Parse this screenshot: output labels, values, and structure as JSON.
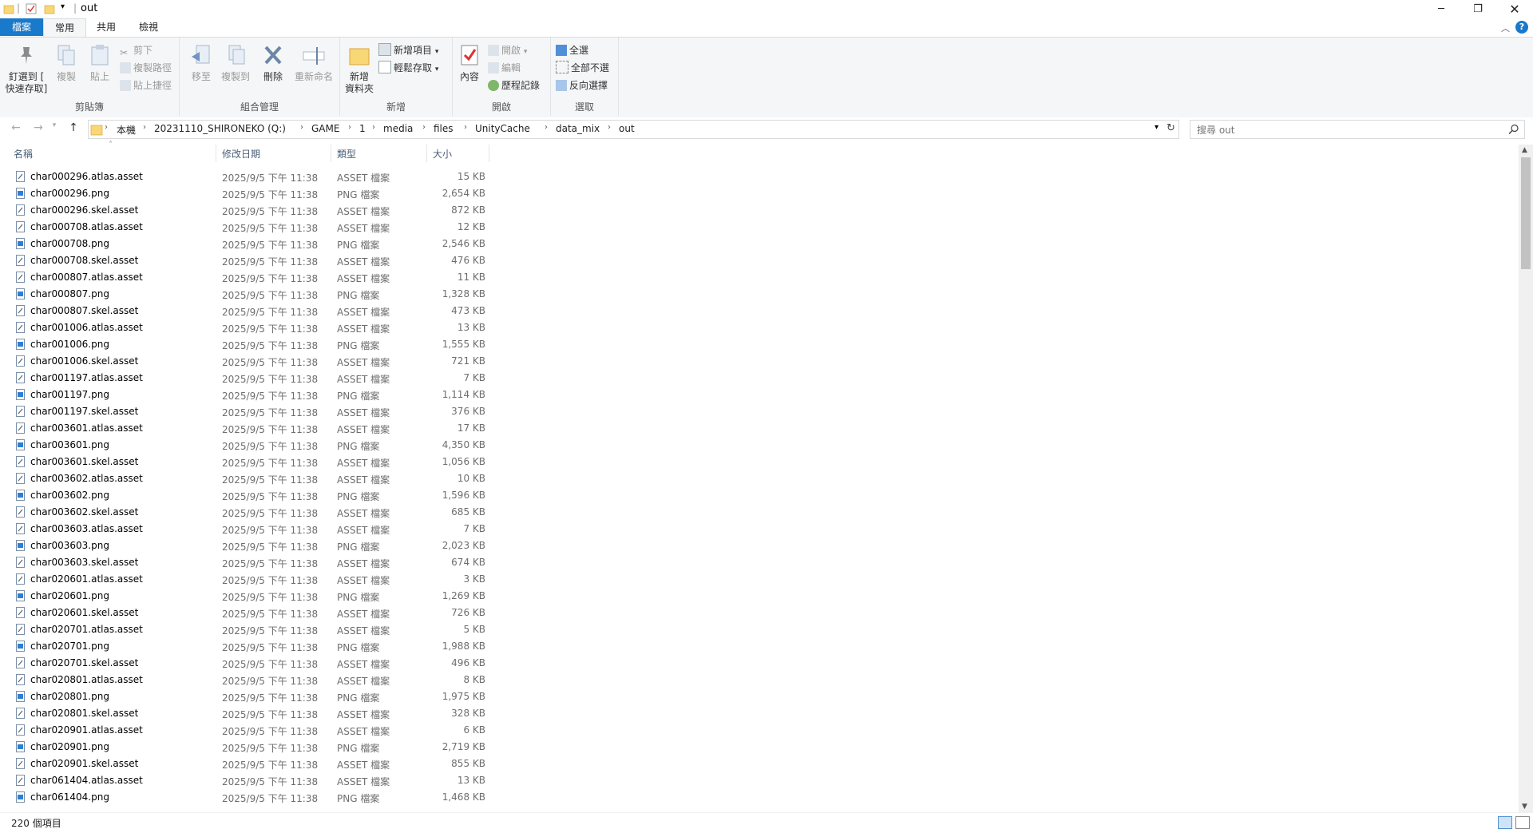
{
  "window": {
    "title": "out"
  },
  "ribbon": {
    "tabs": [
      "檔案",
      "常用",
      "共用",
      "檢視"
    ],
    "clipboard": {
      "pin": "釘選到 [",
      "pin2": "快速存取]",
      "copy": "複製",
      "paste": "貼上",
      "cut": "剪下",
      "copy_path": "複製路徑",
      "paste_shortcut": "貼上捷徑",
      "label": "剪貼簿"
    },
    "organize": {
      "move_to": "移至",
      "copy_to": "複製到",
      "delete": "刪除",
      "rename": "重新命名",
      "label": "組合管理"
    },
    "new": {
      "new_folder": "新增",
      "new_folder2": "資料夾",
      "new_item": "新增項目",
      "easy_access": "輕鬆存取",
      "label": "新增"
    },
    "open": {
      "properties": "內容",
      "open": "開啟",
      "edit": "編輯",
      "history": "歷程記錄",
      "label": "開啟"
    },
    "select": {
      "select_all": "全選",
      "select_none": "全部不選",
      "invert": "反向選擇",
      "label": "選取"
    }
  },
  "address": {
    "crumbs": [
      "本機",
      "20231110_SHIRONEKO (Q:)",
      "GAME",
      "1",
      "media",
      "files",
      "UnityCache",
      "data_mix",
      "out"
    ],
    "search_placeholder": "搜尋 out"
  },
  "columns": {
    "name": "名稱",
    "date": "修改日期",
    "type": "類型",
    "size": "大小"
  },
  "files": [
    {
      "name": "char000296.atlas.asset",
      "date": "2025/9/5 下午 11:38",
      "type": "ASSET 檔案",
      "size": "15 KB"
    },
    {
      "name": "char000296.png",
      "date": "2025/9/5 下午 11:38",
      "type": "PNG 檔案",
      "size": "2,654 KB"
    },
    {
      "name": "char000296.skel.asset",
      "date": "2025/9/5 下午 11:38",
      "type": "ASSET 檔案",
      "size": "872 KB"
    },
    {
      "name": "char000708.atlas.asset",
      "date": "2025/9/5 下午 11:38",
      "type": "ASSET 檔案",
      "size": "12 KB"
    },
    {
      "name": "char000708.png",
      "date": "2025/9/5 下午 11:38",
      "type": "PNG 檔案",
      "size": "2,546 KB"
    },
    {
      "name": "char000708.skel.asset",
      "date": "2025/9/5 下午 11:38",
      "type": "ASSET 檔案",
      "size": "476 KB"
    },
    {
      "name": "char000807.atlas.asset",
      "date": "2025/9/5 下午 11:38",
      "type": "ASSET 檔案",
      "size": "11 KB"
    },
    {
      "name": "char000807.png",
      "date": "2025/9/5 下午 11:38",
      "type": "PNG 檔案",
      "size": "1,328 KB"
    },
    {
      "name": "char000807.skel.asset",
      "date": "2025/9/5 下午 11:38",
      "type": "ASSET 檔案",
      "size": "473 KB"
    },
    {
      "name": "char001006.atlas.asset",
      "date": "2025/9/5 下午 11:38",
      "type": "ASSET 檔案",
      "size": "13 KB"
    },
    {
      "name": "char001006.png",
      "date": "2025/9/5 下午 11:38",
      "type": "PNG 檔案",
      "size": "1,555 KB"
    },
    {
      "name": "char001006.skel.asset",
      "date": "2025/9/5 下午 11:38",
      "type": "ASSET 檔案",
      "size": "721 KB"
    },
    {
      "name": "char001197.atlas.asset",
      "date": "2025/9/5 下午 11:38",
      "type": "ASSET 檔案",
      "size": "7 KB"
    },
    {
      "name": "char001197.png",
      "date": "2025/9/5 下午 11:38",
      "type": "PNG 檔案",
      "size": "1,114 KB"
    },
    {
      "name": "char001197.skel.asset",
      "date": "2025/9/5 下午 11:38",
      "type": "ASSET 檔案",
      "size": "376 KB"
    },
    {
      "name": "char003601.atlas.asset",
      "date": "2025/9/5 下午 11:38",
      "type": "ASSET 檔案",
      "size": "17 KB"
    },
    {
      "name": "char003601.png",
      "date": "2025/9/5 下午 11:38",
      "type": "PNG 檔案",
      "size": "4,350 KB"
    },
    {
      "name": "char003601.skel.asset",
      "date": "2025/9/5 下午 11:38",
      "type": "ASSET 檔案",
      "size": "1,056 KB"
    },
    {
      "name": "char003602.atlas.asset",
      "date": "2025/9/5 下午 11:38",
      "type": "ASSET 檔案",
      "size": "10 KB"
    },
    {
      "name": "char003602.png",
      "date": "2025/9/5 下午 11:38",
      "type": "PNG 檔案",
      "size": "1,596 KB"
    },
    {
      "name": "char003602.skel.asset",
      "date": "2025/9/5 下午 11:38",
      "type": "ASSET 檔案",
      "size": "685 KB"
    },
    {
      "name": "char003603.atlas.asset",
      "date": "2025/9/5 下午 11:38",
      "type": "ASSET 檔案",
      "size": "7 KB"
    },
    {
      "name": "char003603.png",
      "date": "2025/9/5 下午 11:38",
      "type": "PNG 檔案",
      "size": "2,023 KB"
    },
    {
      "name": "char003603.skel.asset",
      "date": "2025/9/5 下午 11:38",
      "type": "ASSET 檔案",
      "size": "674 KB"
    },
    {
      "name": "char020601.atlas.asset",
      "date": "2025/9/5 下午 11:38",
      "type": "ASSET 檔案",
      "size": "3 KB"
    },
    {
      "name": "char020601.png",
      "date": "2025/9/5 下午 11:38",
      "type": "PNG 檔案",
      "size": "1,269 KB"
    },
    {
      "name": "char020601.skel.asset",
      "date": "2025/9/5 下午 11:38",
      "type": "ASSET 檔案",
      "size": "726 KB"
    },
    {
      "name": "char020701.atlas.asset",
      "date": "2025/9/5 下午 11:38",
      "type": "ASSET 檔案",
      "size": "5 KB"
    },
    {
      "name": "char020701.png",
      "date": "2025/9/5 下午 11:38",
      "type": "PNG 檔案",
      "size": "1,988 KB"
    },
    {
      "name": "char020701.skel.asset",
      "date": "2025/9/5 下午 11:38",
      "type": "ASSET 檔案",
      "size": "496 KB"
    },
    {
      "name": "char020801.atlas.asset",
      "date": "2025/9/5 下午 11:38",
      "type": "ASSET 檔案",
      "size": "8 KB"
    },
    {
      "name": "char020801.png",
      "date": "2025/9/5 下午 11:38",
      "type": "PNG 檔案",
      "size": "1,975 KB"
    },
    {
      "name": "char020801.skel.asset",
      "date": "2025/9/5 下午 11:38",
      "type": "ASSET 檔案",
      "size": "328 KB"
    },
    {
      "name": "char020901.atlas.asset",
      "date": "2025/9/5 下午 11:38",
      "type": "ASSET 檔案",
      "size": "6 KB"
    },
    {
      "name": "char020901.png",
      "date": "2025/9/5 下午 11:38",
      "type": "PNG 檔案",
      "size": "2,719 KB"
    },
    {
      "name": "char020901.skel.asset",
      "date": "2025/9/5 下午 11:38",
      "type": "ASSET 檔案",
      "size": "855 KB"
    },
    {
      "name": "char061404.atlas.asset",
      "date": "2025/9/5 下午 11:38",
      "type": "ASSET 檔案",
      "size": "13 KB"
    },
    {
      "name": "char061404.png",
      "date": "2025/9/5 下午 11:38",
      "type": "PNG 檔案",
      "size": "1,468 KB"
    }
  ],
  "status": {
    "count": "220 個項目"
  },
  "colors": {
    "accent": "#1979ca",
    "ribbon_bg": "#f5f6f7",
    "header_text": "#4c607a"
  }
}
